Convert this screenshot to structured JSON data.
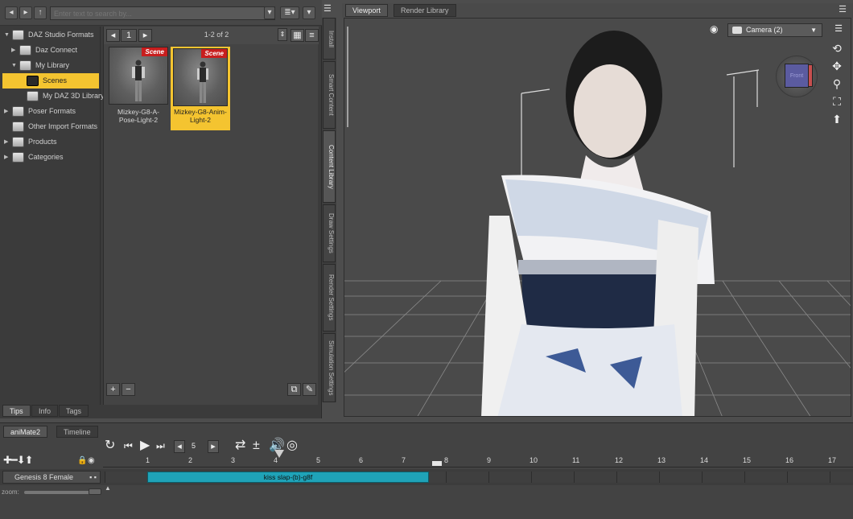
{
  "library": {
    "search_placeholder": "Enter text to search by...",
    "tree": [
      {
        "label": "DAZ Studio Formats",
        "arrow": "▼",
        "indent": 0
      },
      {
        "label": "Daz Connect",
        "arrow": "▶",
        "indent": 1
      },
      {
        "label": "My Library",
        "arrow": "▼",
        "indent": 1
      },
      {
        "label": "Scenes",
        "arrow": "",
        "indent": 2,
        "selected": true
      },
      {
        "label": "My DAZ 3D Library",
        "arrow": "",
        "indent": 2
      },
      {
        "label": "Poser Formats",
        "arrow": "▶",
        "indent": 0
      },
      {
        "label": "Other Import Formats",
        "arrow": "",
        "indent": 0
      },
      {
        "label": "Products",
        "arrow": "▶",
        "indent": 0
      },
      {
        "label": "Categories",
        "arrow": "▶",
        "indent": 0
      }
    ],
    "page_input": "1",
    "page_count": "1-2 of 2",
    "items": [
      {
        "badge": "Scene",
        "caption": "Mizkey-G8-A-Pose-Light-2",
        "selected": false
      },
      {
        "badge": "Scene",
        "caption": "Mizkey-G8-Anim-Light-2",
        "selected": true
      }
    ],
    "add_label": "+",
    "remove_label": "−"
  },
  "side_tabs": [
    "Install",
    "Smart Content",
    "Content Library",
    "Draw Settings",
    "Render Settings",
    "Simulation Settings"
  ],
  "side_tab_active": "Content Library",
  "bottom_tabs": [
    "Tips",
    "Info",
    "Tags"
  ],
  "viewport": {
    "tabs": [
      "Viewport",
      "Render Library"
    ],
    "camera": "Camera (2)",
    "cube_label": "Front"
  },
  "animate": {
    "tabs": [
      "aniMate2",
      "Timeline"
    ],
    "step_value": "5",
    "ruler": [
      "1",
      "2",
      "3",
      "4",
      "5",
      "6",
      "7",
      "8",
      "9",
      "10",
      "11",
      "12",
      "13",
      "14",
      "15",
      "16",
      "17"
    ],
    "track_name": "Genesis 8 Female",
    "clip_name": "kiss slap-(b)-g8f",
    "zoom_label": "zoom:"
  },
  "colors": {
    "selection": "#f4c430",
    "badge": "#c81e1e",
    "clip": "#1fa3b8"
  }
}
